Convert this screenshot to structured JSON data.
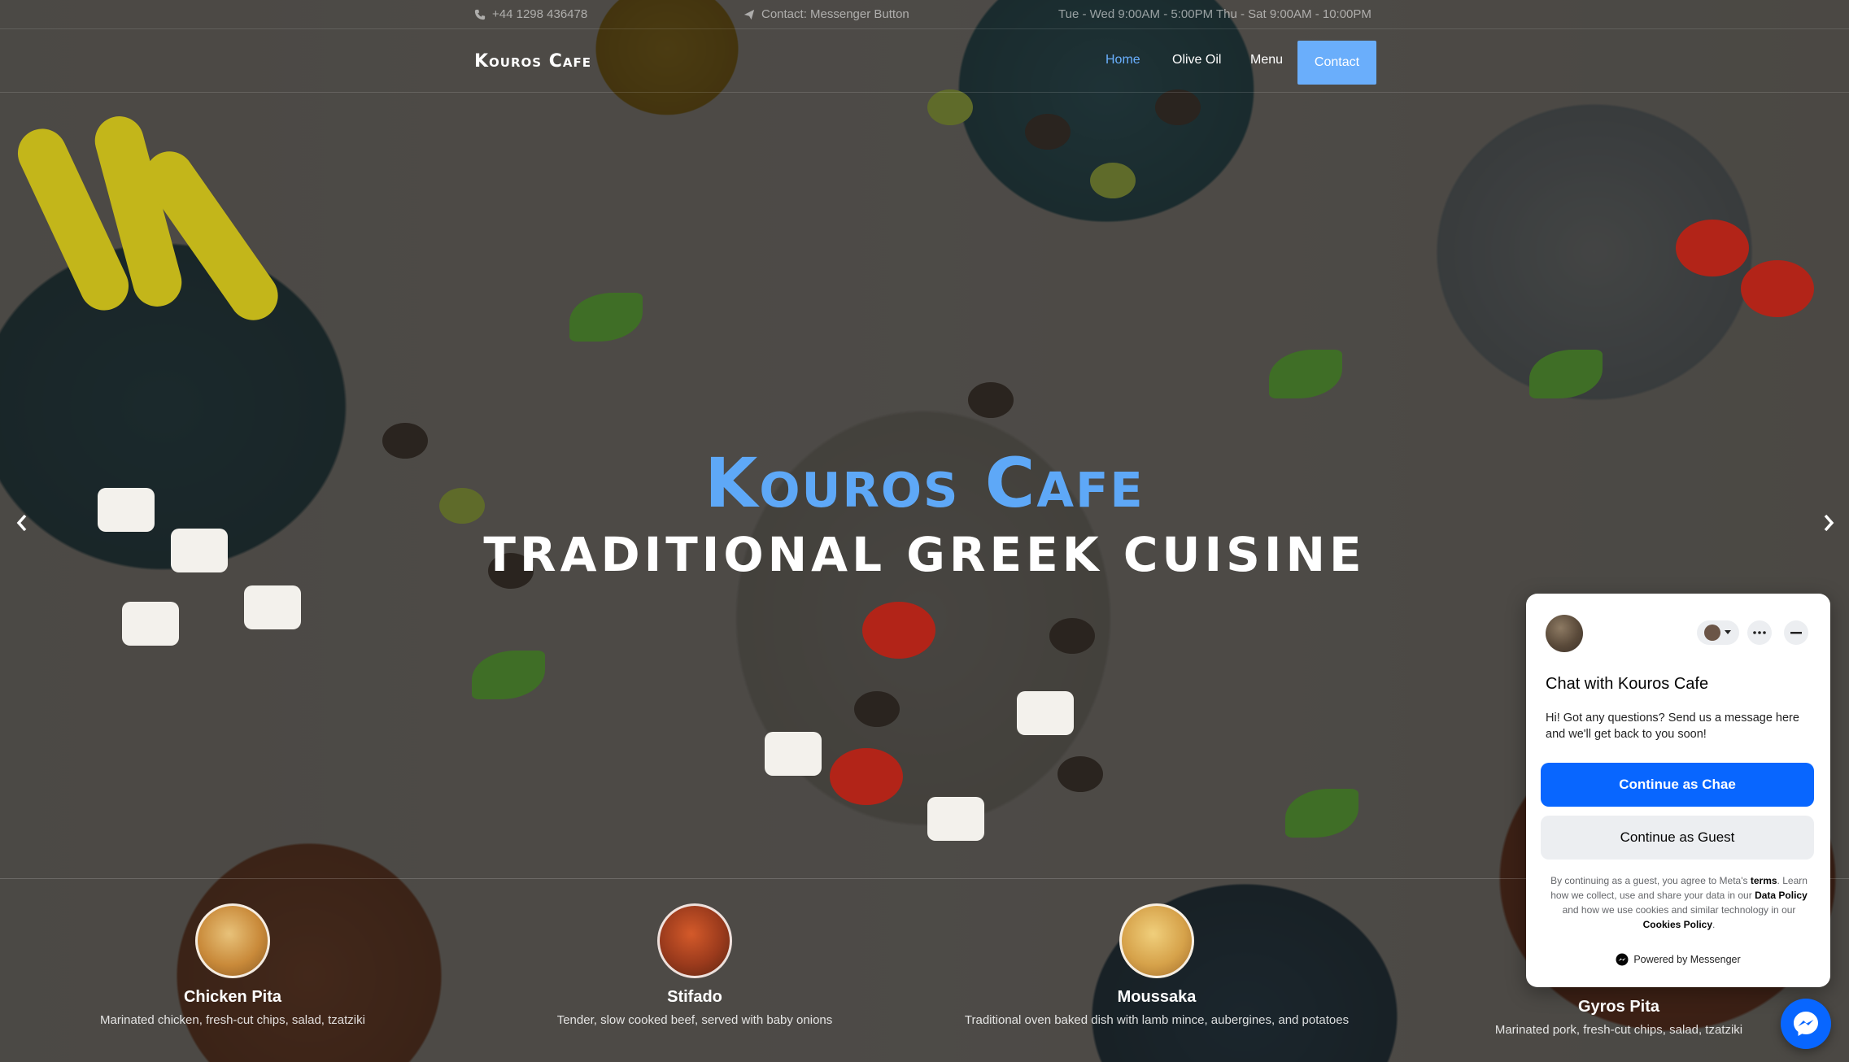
{
  "topbar": {
    "phone": "+44 1298 436478",
    "contact": "Contact: Messenger Button",
    "hours": "Tue - Wed 9:00AM - 5:00PM Thu - Sat 9:00AM - 10:00PM"
  },
  "navbar": {
    "logo": "Kouros Cafe",
    "items": [
      {
        "label": "Home",
        "active": true
      },
      {
        "label": "Olive Oil"
      },
      {
        "label": "Menu"
      },
      {
        "label": "Contact"
      }
    ]
  },
  "hero": {
    "title": "Kouros Cafe",
    "subtitle": "TRADITIONAL GREEK CUISINE",
    "prev_icon": "chevron-left-icon",
    "next_icon": "chevron-right-icon"
  },
  "dishes": [
    {
      "name": "Chicken Pita",
      "desc": "Marinated chicken, fresh-cut chips, salad, tzatziki",
      "color": "#c98a3a"
    },
    {
      "name": "Stifado",
      "desc": "Tender, slow cooked beef, served with baby onions",
      "color": "#9a3a1c"
    },
    {
      "name": "Moussaka",
      "desc": "Traditional oven baked dish with lamb mince, aubergines, and potatoes",
      "color": "#d6a24a"
    },
    {
      "name": "Gyros Pita",
      "desc": "Marinated pork, fresh-cut chips, salad, tzatziki",
      "color": "#b07a44"
    }
  ],
  "chat": {
    "title": "Chat with Kouros Cafe",
    "message": "Hi! Got any questions? Send us a message here and we'll get back to you soon!",
    "primary_button": "Continue as Chae",
    "secondary_button": "Continue as Guest",
    "legal_1": "By continuing as a guest, you agree to Meta's",
    "legal_terms": "terms",
    "legal_2": ". Learn how we collect, use and share your data in our",
    "legal_data_policy": "Data Policy",
    "legal_3": "and how we use cookies and similar technology in our",
    "legal_cookies": "Cookies Policy",
    "legal_4": ".",
    "powered": "Powered by Messenger",
    "brand_color": "#0866ff"
  },
  "colors": {
    "accent": "#5ea8f7",
    "contact_button": "#6aaefb"
  }
}
